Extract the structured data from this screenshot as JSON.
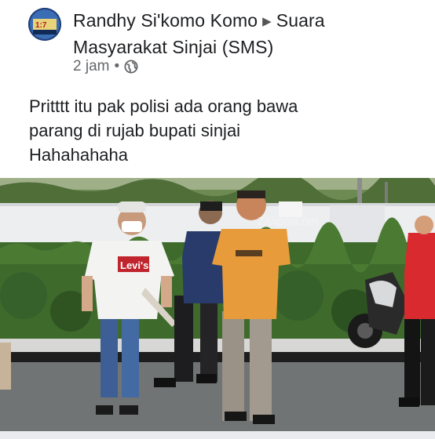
{
  "post": {
    "author": "Randhy Si'komo Komo",
    "group": "Suara Masyarakat Sinjai (SMS)",
    "time": "2 jam",
    "separator": "•",
    "privacy_icon": "globe-icon",
    "arrow_icon": "triangle-right-icon",
    "text_lines": [
      "Pritttt itu pak polisi ada orang bawa",
      "parang di rujab bupati sinjai",
      "Hahahahaha"
    ]
  },
  "photo": {
    "shirt_print": "Levi's",
    "watermark": "Zalipost.net"
  },
  "colors": {
    "text_primary": "#1c1e21",
    "text_secondary": "#65676b"
  }
}
